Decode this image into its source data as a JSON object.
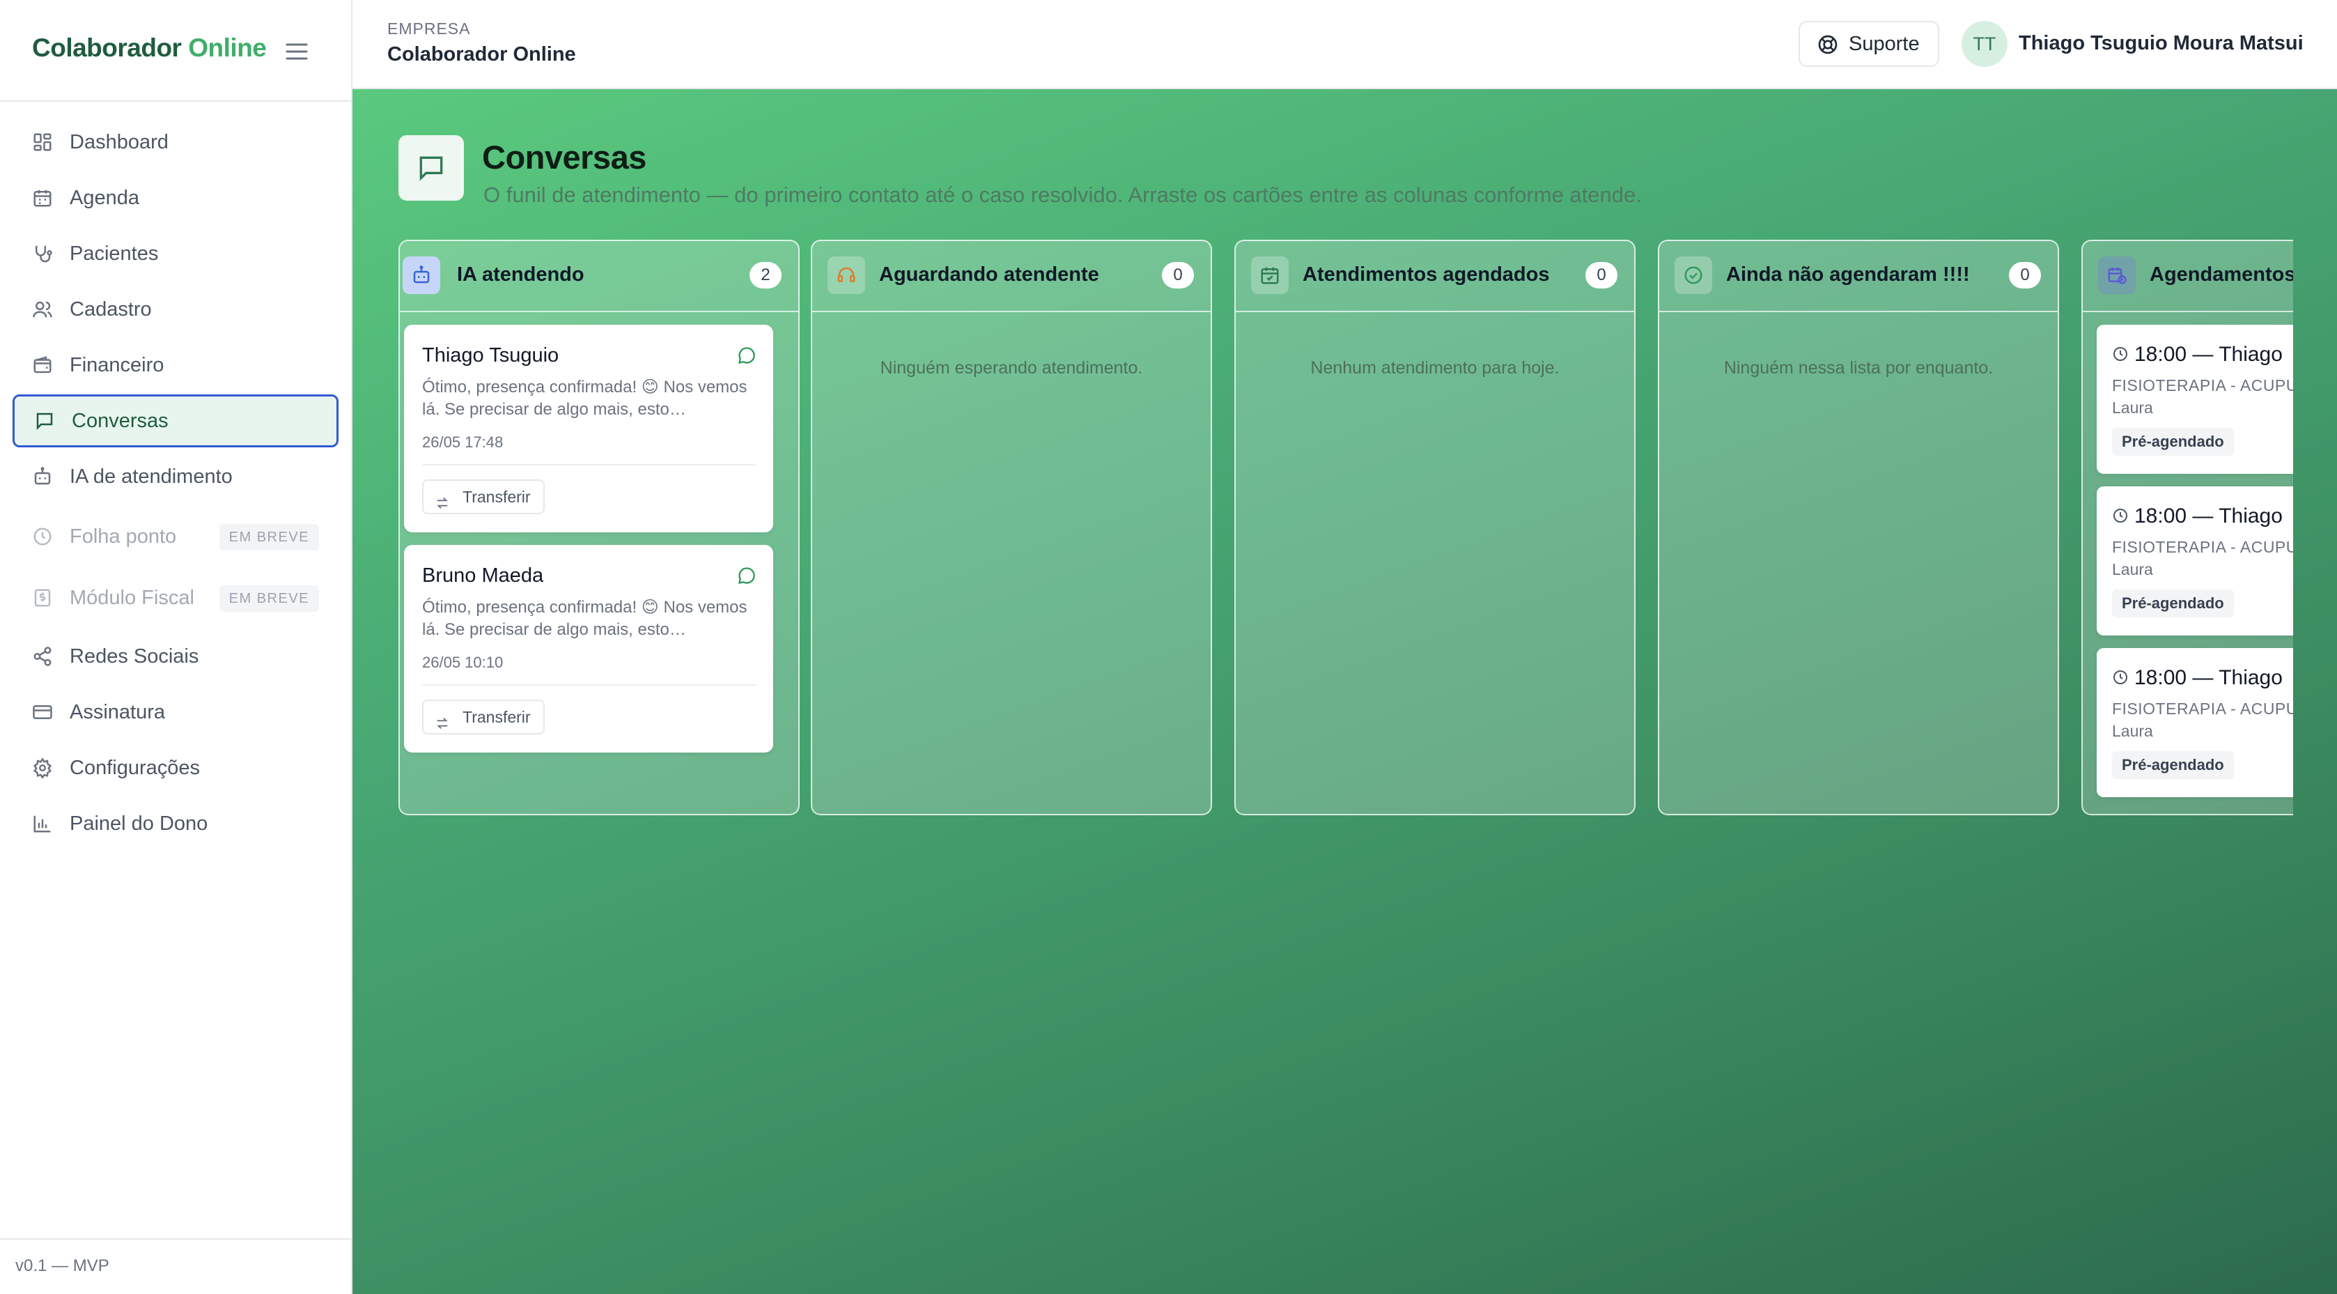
{
  "sidebar": {
    "brand_main": "Colaborador",
    "brand_accent": "Online",
    "items": [
      {
        "label": "Dashboard",
        "icon": "dashboard-icon"
      },
      {
        "label": "Agenda",
        "icon": "calendar-icon"
      },
      {
        "label": "Pacientes",
        "icon": "stethoscope-icon"
      },
      {
        "label": "Cadastro",
        "icon": "users-icon"
      },
      {
        "label": "Financeiro",
        "icon": "wallet-icon"
      },
      {
        "label": "Conversas",
        "icon": "chat-icon",
        "active": true
      },
      {
        "label": "IA de atendimento",
        "icon": "bot-icon"
      },
      {
        "label": "Folha ponto",
        "icon": "clock-icon",
        "badge": "EM BREVE",
        "disabled": true
      },
      {
        "label": "Módulo Fiscal",
        "icon": "dollar-doc-icon",
        "badge": "EM BREVE",
        "disabled": true
      },
      {
        "label": "Redes Sociais",
        "icon": "share-icon"
      },
      {
        "label": "Assinatura",
        "icon": "credit-card-icon"
      },
      {
        "label": "Configurações",
        "icon": "gear-icon"
      },
      {
        "label": "Painel do Dono",
        "icon": "bar-chart-icon"
      }
    ],
    "footer": "v0.1 — MVP"
  },
  "header": {
    "company_label": "EMPRESA",
    "company_name": "Colaborador Online",
    "support_label": "Suporte",
    "avatar_initials": "TT",
    "user_name": "Thiago Tsuguio Moura Matsui"
  },
  "page": {
    "title": "Conversas",
    "subtitle": "O funil de atendimento — do primeiro contato até o caso resolvido. Arraste os cartões entre as colunas conforme atende."
  },
  "columns": [
    {
      "title": "IA atendendo",
      "count": "2",
      "icon": "bot-icon",
      "color": "#3b63d9",
      "cards": [
        {
          "name": "Thiago Tsuguio",
          "message": "Ótimo, presença confirmada! 😊 Nos vemos lá. Se precisar de algo mais, esto…",
          "time": "26/05 17:48",
          "action": "Transferir"
        },
        {
          "name": "Bruno Maeda",
          "message": "Ótimo, presença confirmada! 😊 Nos vemos lá. Se precisar de algo mais, esto…",
          "time": "26/05 10:10",
          "action": "Transferir"
        }
      ]
    },
    {
      "title": "Aguardando atendente",
      "count": "0",
      "icon": "headset-icon",
      "color": "#e07a2b",
      "empty": "Ninguém esperando atendimento."
    },
    {
      "title": "Atendimentos agendados",
      "count": "0",
      "icon": "calendar-check-icon",
      "color": "#2f7a52",
      "empty": "Nenhum atendimento para hoje."
    },
    {
      "title": "Ainda não agendaram !!!!",
      "count": "0",
      "icon": "check-circle-icon",
      "color": "#2f9a5a",
      "empty": "Ninguém nessa lista por enquanto."
    },
    {
      "title": "Agendamentos",
      "icon": "calendar-clock-icon",
      "color": "#5b5bd6",
      "appointments": [
        {
          "time": "18:00 — Thiago",
          "procedure": "FISIOTERAPIA - ACUPU",
          "who": "Laura",
          "status": "Pré-agendado"
        },
        {
          "time": "18:00 — Thiago",
          "procedure": "FISIOTERAPIA - ACUPU",
          "who": "Laura",
          "status": "Pré-agendado"
        },
        {
          "time": "18:00 — Thiago",
          "procedure": "FISIOTERAPIA - ACUPU",
          "who": "Laura",
          "status": "Pré-agendado"
        }
      ]
    }
  ]
}
